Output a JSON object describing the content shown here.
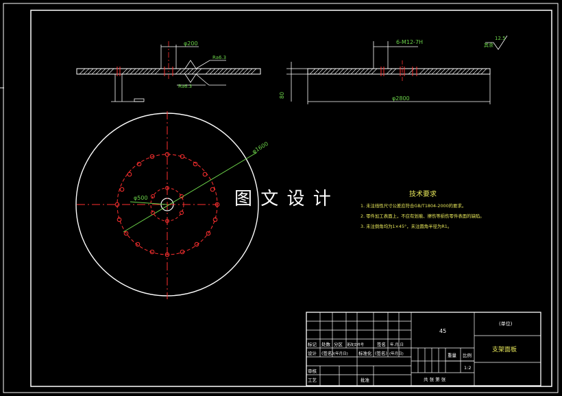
{
  "top_left_view": {
    "dim_diameter": "φ200",
    "roughness_1": "Ra6.3",
    "roughness_2": "Ra6.3"
  },
  "top_right_view": {
    "thread_callout": "6-M12-7H",
    "roughness_label": "12.5",
    "roughness_note": "其余",
    "dim_height": "80",
    "dim_overall": "φ2800"
  },
  "plan_view": {
    "dim_outer": "φ1600",
    "dim_inner": "φ500"
  },
  "watermark": "图 文 设 计",
  "technical_requirements": {
    "title": "技术要求",
    "items": [
      "1. 未注线性尺寸公差应符合GB/T1804-2000的要求。",
      "2. 零件加工表面上，不应有划痕、擦伤等损伤零件表面的缺陷。",
      "3. 未注倒角均为1×45°，未注圆角半径为R1。"
    ]
  },
  "title_block": {
    "row_labels": {
      "mark": "标记",
      "count": "处数",
      "zone": "分区",
      "change_doc": "更改文件号",
      "sign": "签名",
      "date": "年.月.日",
      "designer": "设计",
      "sign_paren": "(签名)",
      "date_paren": "(年月日)",
      "standardize": "标准化",
      "check": "审核",
      "process": "工艺",
      "approve": "批准"
    },
    "material": "45",
    "unit_name": "(单位)",
    "drawing_name": "支架面板",
    "weight_label": "重量",
    "scale_label": "比例",
    "scale_value": "1:2",
    "sheets_text": "共  张  第  张"
  }
}
